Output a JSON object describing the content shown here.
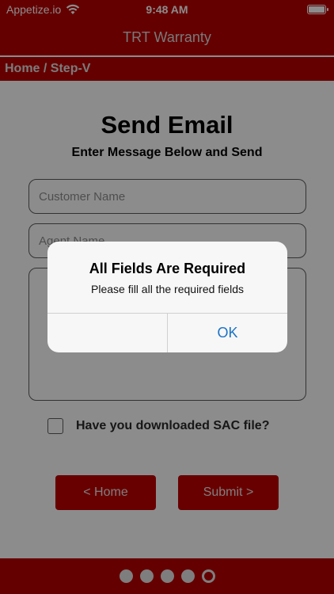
{
  "status_bar": {
    "carrier": "Appetize.io",
    "time": "9:48 AM"
  },
  "nav": {
    "title": "TRT Warranty"
  },
  "breadcrumb": "Home / Step-V",
  "form": {
    "title": "Send Email",
    "subtitle": "Enter Message Below and Send",
    "customer_name_placeholder": "Customer Name",
    "agent_name_placeholder": "Agent Name",
    "message_value": "",
    "checkbox_label": "Have you downloaded SAC file?",
    "checkbox_checked": false,
    "home_button": "< Home",
    "submit_button": "Submit >"
  },
  "pager": {
    "total": 5,
    "active_index": 4
  },
  "alert": {
    "title": "All Fields Are Required",
    "message": "Please fill all the required fields",
    "left_button": "",
    "ok_button": "OK"
  },
  "colors": {
    "brand_red": "#b80000",
    "button_red": "#c00000",
    "alert_link_blue": "#1a73c8"
  }
}
